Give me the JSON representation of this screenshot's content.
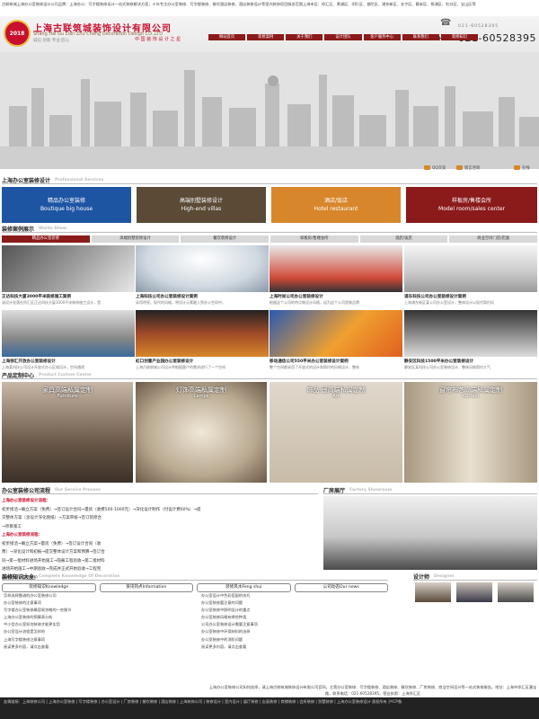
{
  "top_note": "古联筑城上海办公室装修设计公司品牌：上海办公：写字楼装修设计一站式装修解决方案；十年专注办公室装修、写字楼装修、餐饮酒店装修、酒店装修设计等室内装饰项目服务范围上海市区：徐汇区、黄浦区、闵行区、普陀区、浦东新区、长宁区、静安区、杨浦区、虹口区、宝山区等",
  "header": {
    "logo_text": "2018",
    "company_cn": "上海古联筑城装饰设计有限公司",
    "company_en": "Shang Hai Gu Lian Zhu Cheng Decoration Design CO.,LTD",
    "company_sub": "诚信·创新·专业·匠心",
    "slogan": "中 国 装 饰 设 计 之 星",
    "hotline_label": "HOTLINE",
    "phone_small": "021-60528395",
    "phone": "021-60528395"
  },
  "nav": [
    "网站首页",
    "装修案例",
    "关于我们",
    "设计团队",
    "客户服务中心",
    "联系我们",
    "装修知识"
  ],
  "quick": [
    "QQ交谈",
    "留言咨询",
    "在线"
  ],
  "services": {
    "title": "上海办公室装修设计",
    "en": "Professional Services",
    "items": [
      {
        "cn": "精品办公室装修",
        "en": "Boutique big house",
        "color": "#1e55a3"
      },
      {
        "cn": "高端别墅装修设计",
        "en": "High-end villas",
        "color": "#5a4a36"
      },
      {
        "cn": "酒店/饭店",
        "en": "Hotel restaurant",
        "color": "#d8862b"
      },
      {
        "cn": "样板房/售楼会所",
        "en": "Model room/sales center",
        "color": "#8b1a1a"
      }
    ]
  },
  "cases": {
    "title": "装修案例展示",
    "en": "Works Show",
    "tabs": [
      "精品办公室装修",
      "高端别墅装修设计",
      "餐饮装修设计",
      "样板房/售楼会所",
      "酒店/饭店",
      "商业空间门店/店面"
    ],
    "items": [
      {
        "title": "正达科技大厦3000平米装修施工案例",
        "desc": "该设计坐落在徐汇区正达科技大厦3000平米装修施工设计，是"
      },
      {
        "title": "上海科技公司办公室装修设计案例",
        "desc": "采用明亮、现代的风格，将设计元素融入到办公空间中。"
      },
      {
        "title": "上海时尚公司办公室装修设计",
        "desc": "根据这个公司的特点做设计风格，因为这个公司是做品牌"
      },
      {
        "title": "浦东科技公司办公室装修设计案例",
        "desc": "上海浦东新区某公司办公室设计，整体设计以现代简约风"
      },
      {
        "title": "上海徐汇开放办公室装修设计",
        "desc": "上海某科技公司设计开放式办公区域设计，空间通透"
      },
      {
        "title": "虹口创意产业园办公室装修设计",
        "desc": "上海古联筑城公司设计师根据客户的需求进行了一个空间"
      },
      {
        "title": "移动通信公司550平米办公室装修设计案例",
        "desc": "整个空间都采用了开放式的设计和简约的风格设计，整体"
      },
      {
        "title": "静安区科技1500平米办公室装修设计",
        "desc": "静安区某科技公司办公室装修设计，整体风格简约大气"
      }
    ]
  },
  "products": {
    "title": "产品定制中心",
    "en": "Product Custom Center",
    "items": [
      {
        "cn": "家具高端私属定制",
        "en": "Furniture"
      },
      {
        "cn": "灯饰高端私属定制",
        "en": "Lamps"
      },
      {
        "cn": "饰品·画高端私属定制",
        "en": "Art"
      },
      {
        "cn": "窗帘布艺高端私属定制",
        "en": "Curtain"
      }
    ]
  },
  "process": {
    "title": "办公室装修公司流程",
    "en": "Our Service Process",
    "lines": [
      "上海办公室装修设计流程：",
      "初步接洽→确立方案（免费）→签订设计合同→量房（收费500-1000元）→深化设计制作（付设计费60%）→提",
      "交整体方案（含设计深化图纸）→方案审核→签订装修合",
      "→项目施工",
      "上海办公室装修流程：",
      "初步接洽→确立方案→量房（免费）→签订设计合同（收",
      "费）→深化设计和初报→提交整体设计方案和预算→签订合",
      "同→第一批材料进场开始施工→隐蔽工程验收→第二批材料",
      "进场开始施工→中期验收→完成并正式开始验收→工程完",
      "成并验收→成品保护"
    ]
  },
  "factory": {
    "title": "厂房展厅",
    "en": "Factory Showroom"
  },
  "knowledge": {
    "title": "装修知识大全",
    "en": "Complete Knowledge Of Decoration",
    "tabs": [
      "装修知识Knowledge",
      "资讯热点Information",
      "装修风水Feng shui",
      "公司动态Our news"
    ],
    "left": [
      "怎样选择靠谱的办公室装修公司",
      "办公室装修的注意事项",
      "写字楼办公室装修最容易忽略的一些细节",
      "上海办公室装修的预算表分析",
      "中小型办公室如何装修才能更实用",
      "办公室设计流程是怎样的",
      "上海写字楼装修注意事项"
    ],
    "mid": [
      "办公室设计中色彩搭配的技巧",
      "办公室装修要注意的问题",
      "办公室装修中照明设计的重点",
      "办公室装修风格有哪些种类",
      "公司办公室装修设计需要注意事项",
      "办公室装修中环保材料的选择",
      "办公室装修中的消防问题",
      "办公室装修风格的选择"
    ],
    "more": "阅读更多内容，请点击查看"
  },
  "designers": {
    "title": "设计师",
    "en": "Designer"
  },
  "footer": {
    "about": "上海办公室装修公司如何选择，请上海古联筑城装饰设计有限公司官网，主营办公室装修、写字楼装修、酒店装修、餐饮装修、厂房装修、商业空间设计等一站式装修服务。地址：上海市徐汇区漕宝路，联系电话：021-60528395，营业执照：上海徐汇区",
    "bottom": "友情链接：上海装修公司 | 上海办公室装修 | 写字楼装修 | 办公室设计 | 厂房装修 | 餐饮装修 | 酒店装修 | 上海装饰公司 | 装修设计 | 室内设计 | 展厅装修 | 店面装修 | 商铺装修 | 会所装修 | 别墅装修 | 上海办公室装修设计 版权所有 沪ICP备"
  },
  "colors": {
    "brand": "#8b1a1a",
    "accent": "#c8102e",
    "orange": "#d8862b"
  }
}
